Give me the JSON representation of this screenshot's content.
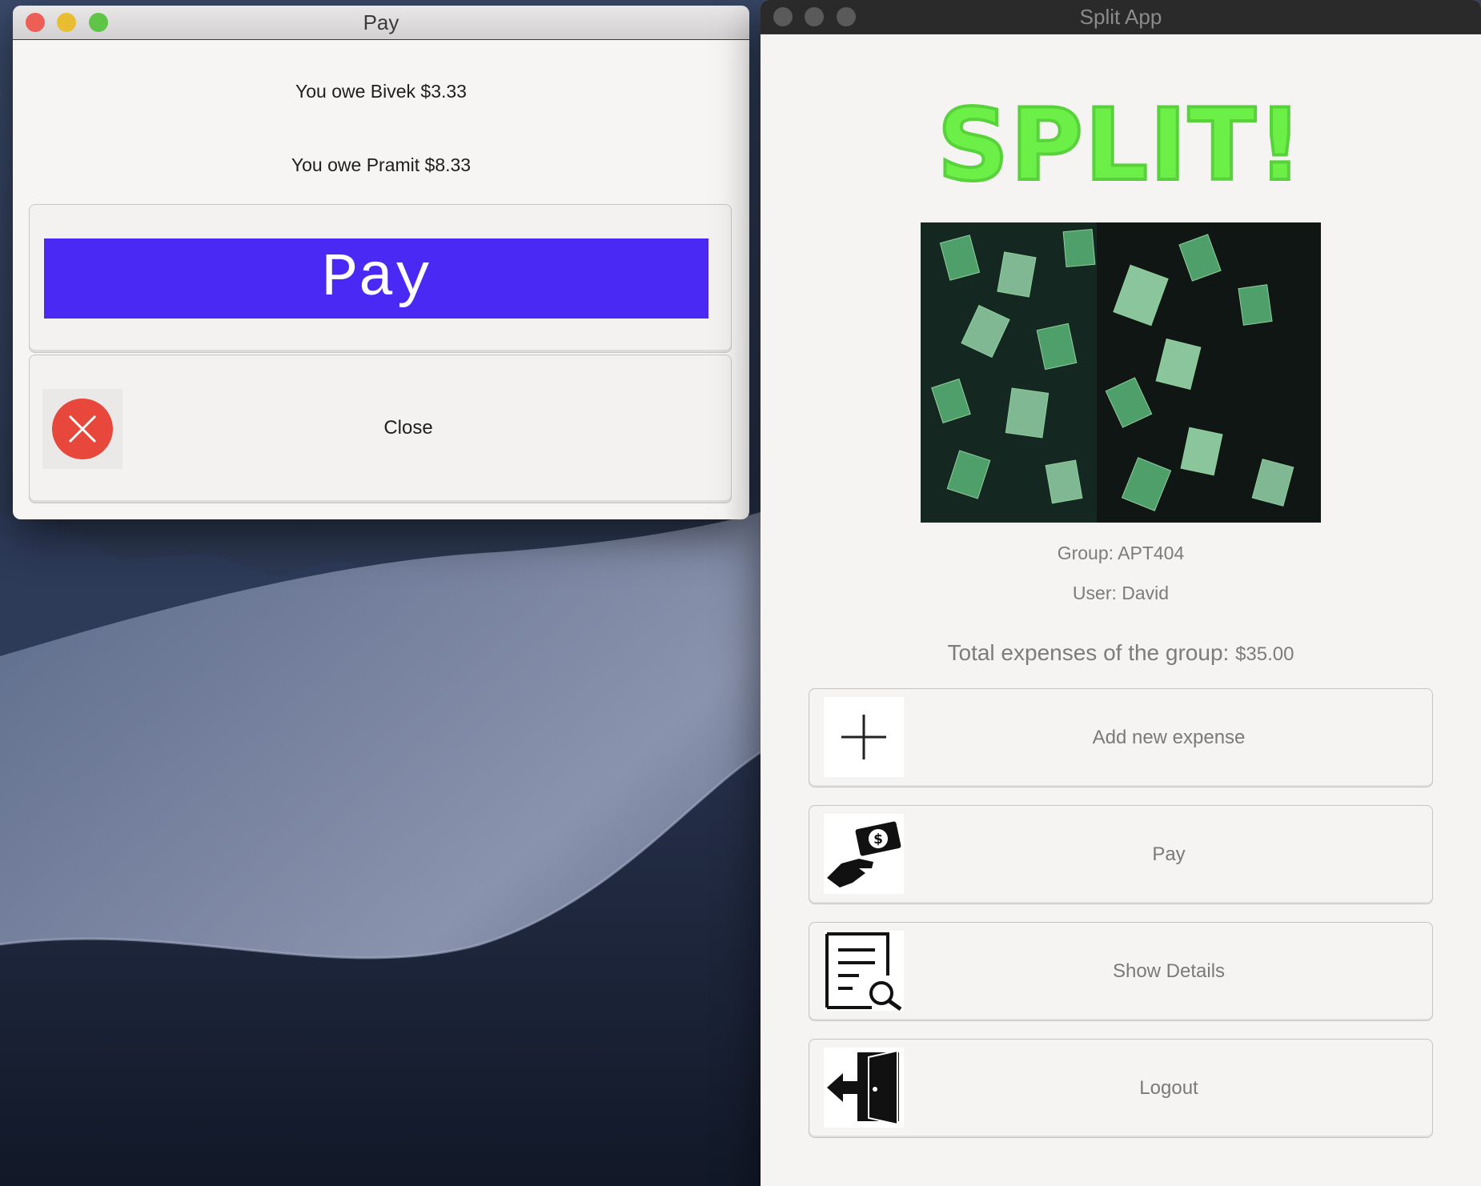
{
  "pay_window": {
    "title": "Pay",
    "owe_lines": [
      "You owe Bivek $3.33",
      "You owe Pramit $8.33"
    ],
    "pay_button_label": "Pay",
    "close_button_label": "Close",
    "accent_color": "#4b29f5"
  },
  "split_window": {
    "title": "Split App",
    "logo_text": "SPLIT!",
    "logo_color": "#6cf048",
    "group_label": "Group: APT404",
    "user_label": "User: David",
    "total_label": "Total expenses of the group:",
    "total_amount": "$35.00",
    "actions": [
      {
        "label": "Add new expense",
        "icon": "plus-icon"
      },
      {
        "label": "Pay",
        "icon": "hand-money-icon"
      },
      {
        "label": "Show Details",
        "icon": "document-search-icon"
      },
      {
        "label": "Logout",
        "icon": "exit-door-icon"
      }
    ]
  },
  "traffic_light_colors": {
    "close": "#ed5f56",
    "minimize": "#e9bd32",
    "zoom": "#5fc547"
  }
}
